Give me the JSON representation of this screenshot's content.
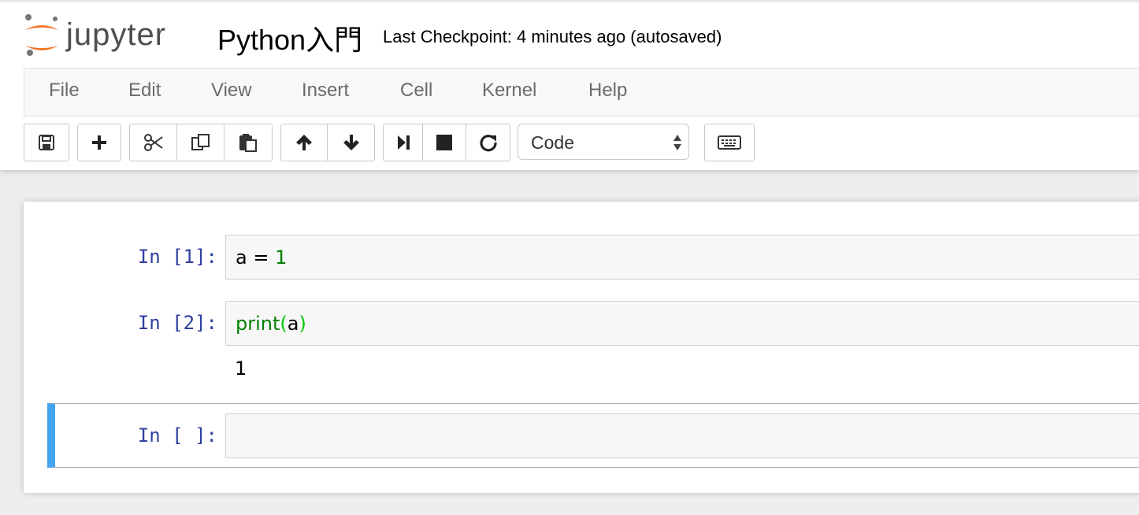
{
  "header": {
    "logo_text": "jupyter",
    "notebook_title": "Python入門",
    "checkpoint": "Last Checkpoint: 4 minutes ago (autosaved)"
  },
  "menu": {
    "items": [
      "File",
      "Edit",
      "View",
      "Insert",
      "Cell",
      "Kernel",
      "Help"
    ]
  },
  "toolbar": {
    "buttons": [
      "save-icon",
      "plus-icon",
      "scissors-icon",
      "copy-icon",
      "paste-icon",
      "arrow-up-icon",
      "arrow-down-icon",
      "step-forward-icon",
      "stop-icon",
      "restart-icon",
      "keyboard-icon"
    ],
    "cell_type": "Code"
  },
  "cells": [
    {
      "prompt": "In [1]:",
      "code_var": "a",
      "code_op": " = ",
      "code_num": "1",
      "output": ""
    },
    {
      "prompt": "In [2]:",
      "code_fn": "print",
      "code_open": "(",
      "code_arg": "a",
      "code_close": ")",
      "output": "1"
    },
    {
      "prompt": "In [ ]:",
      "code": "",
      "output": ""
    }
  ],
  "colors": {
    "prompt": "#303f9f",
    "keyword": "#008000",
    "selected_cell": "#42a5f5",
    "logo_orange": "#f37726"
  }
}
